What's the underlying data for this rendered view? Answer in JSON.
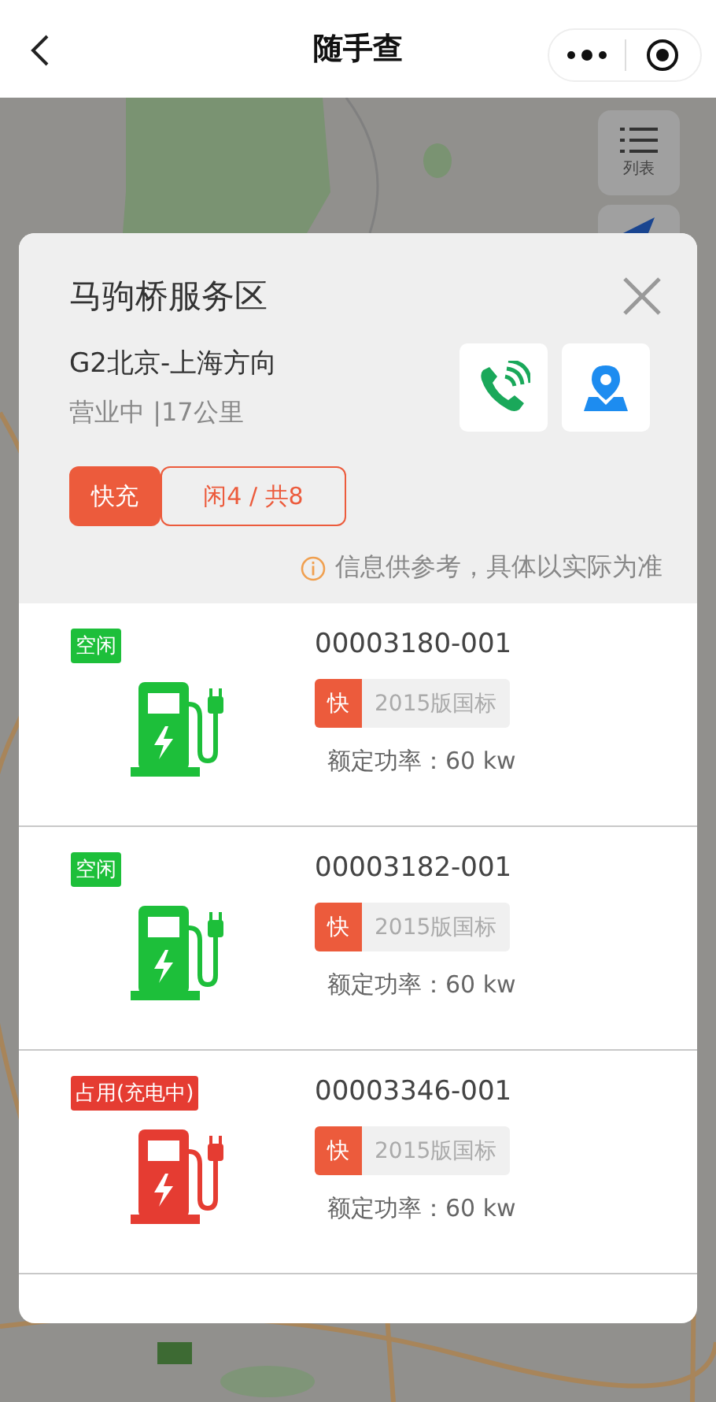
{
  "nav": {
    "title": "随手查"
  },
  "map": {
    "kind": "picture",
    "list_button": {
      "label": "列表"
    }
  },
  "card": {
    "title": "马驹桥服务区",
    "direction": "G2北京-上海方向",
    "status": "营业中 |17公里",
    "tags": [
      {
        "text": "快充",
        "kind": "filled"
      },
      {
        "text": "闲4 / 共8",
        "kind": "outline"
      }
    ],
    "notice": "信息供参考，具体以实际为准"
  },
  "chargers": [
    {
      "status": "空闲",
      "color": "#1dbf3a",
      "id": "00003180-001",
      "speed": "快",
      "standard": "2015版国标",
      "power": "额定功率：60 kw"
    },
    {
      "status": "空闲",
      "color": "#1dbf3a",
      "id": "00003182-001",
      "speed": "快",
      "standard": "2015版国标",
      "power": "额定功率：60 kw"
    },
    {
      "status": "占用(充电中)",
      "color": "#e53c32",
      "id": "00003346-001",
      "speed": "快",
      "standard": "2015版国标",
      "power": "额定功率：60 kw"
    }
  ]
}
